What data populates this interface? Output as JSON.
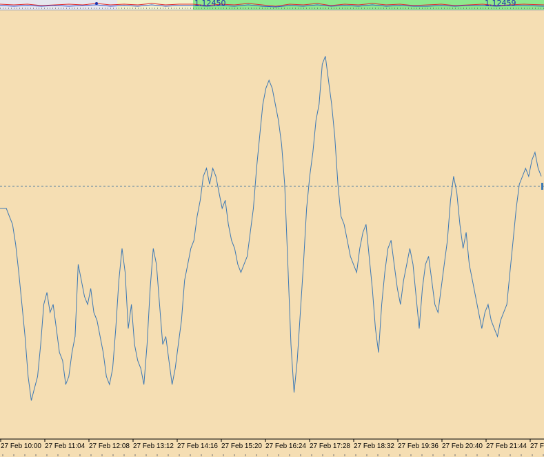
{
  "top_strip": {
    "labels": [
      "1.12450",
      "1.12459"
    ]
  },
  "chart_data": {
    "type": "line",
    "title": "",
    "xlabel": "",
    "ylabel": "",
    "grid": false,
    "x_ticks": [
      "27 Feb 10:00",
      "27 Feb 11:04",
      "27 Feb 12:08",
      "27 Feb 13:12",
      "27 Feb 14:16",
      "27 Feb 15:20",
      "27 Feb 16:24",
      "27 Feb 17:28",
      "27 Feb 18:32",
      "27 Feb 19:36",
      "27 Feb 20:40",
      "27 Feb 21:44",
      "27 F"
    ],
    "ylim": [
      0,
      100
    ],
    "reference_line": 59.5,
    "series": [
      {
        "color": "#3c78b4",
        "values": [
          54,
          54,
          54,
          52,
          50,
          45,
          38,
          30,
          22,
          12,
          6,
          9,
          12,
          20,
          30,
          33,
          28,
          30,
          24,
          18,
          16,
          10,
          12,
          18,
          22,
          40,
          36,
          32,
          30,
          34,
          28,
          26,
          22,
          18,
          12,
          10,
          14,
          24,
          36,
          44,
          38,
          24,
          30,
          20,
          16,
          14,
          10,
          20,
          34,
          44,
          40,
          30,
          20,
          22,
          16,
          10,
          14,
          20,
          26,
          36,
          40,
          44,
          46,
          52,
          56,
          62,
          64,
          60,
          64,
          62,
          58,
          54,
          56,
          50,
          46,
          44,
          40,
          38,
          40,
          42,
          48,
          54,
          64,
          72,
          80,
          84,
          86,
          84,
          80,
          76,
          70,
          60,
          40,
          20,
          8,
          16,
          28,
          40,
          54,
          62,
          68,
          76,
          80,
          90,
          92,
          86,
          80,
          72,
          60,
          52,
          50,
          46,
          42,
          40,
          38,
          44,
          48,
          50,
          42,
          34,
          24,
          18,
          30,
          38,
          44,
          46,
          40,
          34,
          30,
          36,
          40,
          44,
          40,
          32,
          24,
          34,
          40,
          42,
          36,
          30,
          28,
          34,
          40,
          46,
          56,
          62,
          58,
          50,
          44,
          48,
          40,
          36,
          32,
          28,
          24,
          28,
          30,
          26,
          24,
          22,
          26,
          28,
          30,
          38,
          46,
          54,
          60,
          62,
          64,
          62,
          66,
          68,
          64,
          62
        ]
      }
    ]
  }
}
